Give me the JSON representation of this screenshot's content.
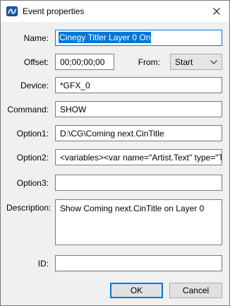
{
  "window": {
    "title": "Event properties"
  },
  "fields": {
    "name": {
      "label": "Name:",
      "value": "Cinegy Titler Layer 0 On"
    },
    "offset": {
      "label": "Offset:",
      "value": "00;00;00;00"
    },
    "from": {
      "label": "From:",
      "selected": "Start"
    },
    "device": {
      "label": "Device:",
      "value": "*GFX_0"
    },
    "command": {
      "label": "Command:",
      "value": "SHOW"
    },
    "option1": {
      "label": "Option1:",
      "value": "D:\\CG\\Coming next.CinTitle"
    },
    "option2": {
      "label": "Option2:",
      "value": "<variables><var name=\"Artist.Text\" type=\"Te"
    },
    "option3": {
      "label": "Option3:",
      "value": ""
    },
    "description": {
      "label": "Description:",
      "value": "Show Coming next.CinTitle on Layer 0"
    },
    "id": {
      "label": "ID:",
      "value": ""
    }
  },
  "buttons": {
    "ok": "OK",
    "cancel": "Cancel"
  },
  "colors": {
    "accent": "#0078d7",
    "selection": "#0078d7",
    "dialog_bg": "#f0f0f0"
  }
}
